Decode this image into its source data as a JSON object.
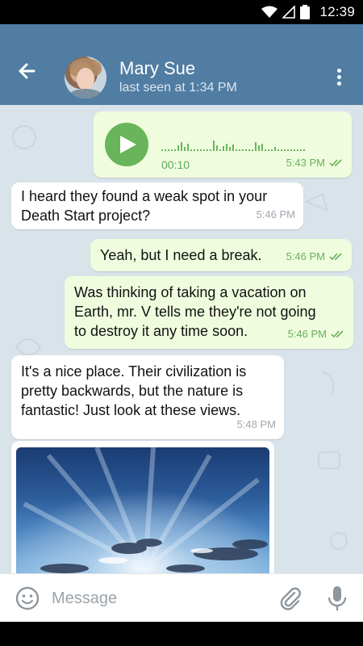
{
  "status_bar": {
    "time": "12:39",
    "icons": [
      "wifi-icon",
      "signal-icon",
      "battery-icon"
    ]
  },
  "header": {
    "contact_name": "Mary Sue",
    "last_seen": "last seen at 1:34 PM",
    "back_icon": "arrow-left-icon",
    "menu_icon": "more-vertical-icon"
  },
  "messages": [
    {
      "type": "voice",
      "direction": "out",
      "duration": "00:10",
      "time": "5:43 PM",
      "read": true
    },
    {
      "type": "text",
      "direction": "in",
      "text": "I heard they found a weak spot in your\nDeath Start project?",
      "time": "5:46 PM"
    },
    {
      "type": "text",
      "direction": "out",
      "text": "Yeah, but I need a break.",
      "time": "5:46 PM",
      "read": true
    },
    {
      "type": "text",
      "direction": "out",
      "text": "Was thinking of taking a vacation on\nEarth, mr. V tells me they're not going\nto destroy it any time soon.",
      "time": "5:46 PM",
      "read": true
    },
    {
      "type": "text",
      "direction": "in",
      "text": "It's a nice place. Their civilization is\npretty backwards, but the nature is\nfantastic! Just look at these views.",
      "time": "5:48 PM"
    },
    {
      "type": "photo",
      "direction": "in",
      "description_icon": "landscape-photo"
    }
  ],
  "composer": {
    "placeholder": "Message",
    "value": "",
    "emoji_icon": "emoji-icon",
    "attach_icon": "paperclip-icon",
    "mic_icon": "microphone-icon"
  },
  "colors": {
    "header": "#517da2",
    "chat_bg": "#d9e3ea",
    "out_bubble": "#effdde",
    "in_bubble": "#ffffff",
    "accent_green": "#68b55b"
  }
}
